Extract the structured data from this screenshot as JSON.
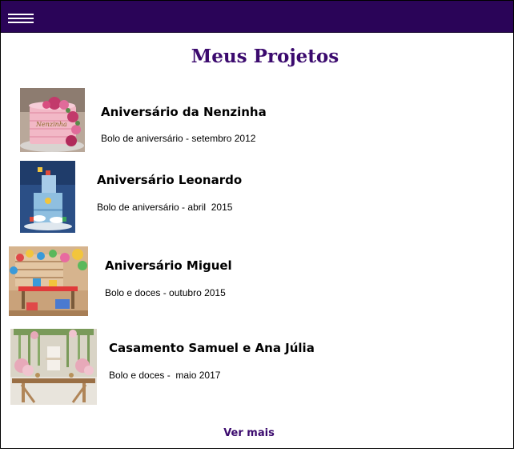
{
  "header": {
    "menu_icon": "hamburger-menu-icon"
  },
  "page": {
    "title": "Meus Projetos"
  },
  "projects": [
    {
      "title": "Aniversário da Nenzinha",
      "subtitle": "Bolo de aniversário - setembro 2012",
      "image": "pink-floral-cake-photo"
    },
    {
      "title": "Aniversário Leonardo",
      "subtitle": "Bolo de aniversário - abril  2015",
      "image": "blue-themed-cake-photo"
    },
    {
      "title": "Aniversário Miguel",
      "subtitle": "Bolo e doces - outubro 2015",
      "image": "colorful-party-table-photo"
    },
    {
      "title": "Casamento Samuel e Ana Júlia",
      "subtitle": "Bolo e doces -  maio 2017",
      "image": "rustic-wedding-table-photo"
    }
  ],
  "footer": {
    "more_link": "Ver mais"
  },
  "colors": {
    "header_bg": "#2a0458",
    "title": "#3b0a6e",
    "link": "#3b0a6e"
  }
}
